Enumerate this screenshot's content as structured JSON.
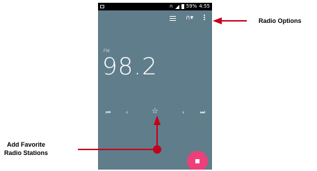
{
  "status_bar": {
    "battery": "59%",
    "time": "4:55"
  },
  "toolbar": {
    "icons": [
      "list-icon",
      "headset-icon",
      "more-vert-icon"
    ]
  },
  "radio": {
    "band": "FM",
    "frequency": "98.2"
  },
  "controls": {
    "prev_station": "⏮",
    "prev": "‹",
    "favorite": "☆",
    "next": "›",
    "next_station": "⏭"
  },
  "annotations": {
    "radio_options": "Radio Options",
    "add_favorite_line1": "Add Favorite",
    "add_favorite_line2": "Radio Stations"
  },
  "colors": {
    "screen_background": "#607d8b",
    "fab": "#ec407a",
    "arrow": "#c4001a"
  }
}
